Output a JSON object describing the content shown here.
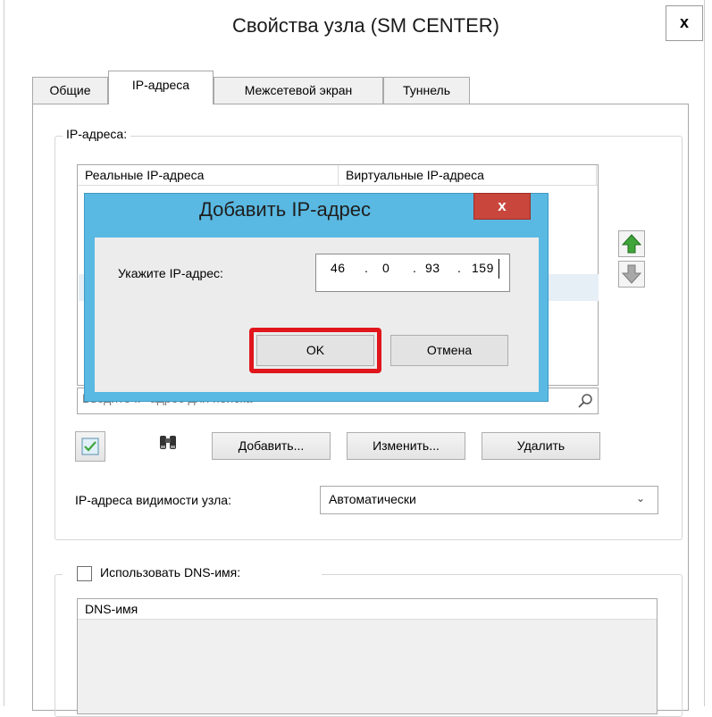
{
  "window": {
    "title": "Свойства узла (SM CENTER)",
    "close_label": "x"
  },
  "tabs": [
    {
      "label": "Общие",
      "active": false
    },
    {
      "label": "IP-адреса",
      "active": true
    },
    {
      "label": "Межсетевой экран",
      "active": false
    },
    {
      "label": "Туннель",
      "active": false
    }
  ],
  "ip_group": {
    "legend": "IP-адреса:",
    "columns": [
      "Реальные IP-адреса",
      "Виртуальные IP-адреса"
    ],
    "search_placeholder": "Введите IP-адрес для поиска",
    "buttons": {
      "add": "Добавить...",
      "edit": "Изменить...",
      "delete": "Удалить"
    },
    "visibility_label": "IP-адреса видимости узла:",
    "visibility_value": "Автоматически"
  },
  "dns_group": {
    "checkbox_label": "Использовать DNS-имя:",
    "checked": false,
    "column": "DNS-имя"
  },
  "dialog": {
    "title": "Добавить IP-адрес",
    "close_label": "x",
    "prompt": "Укажите IP-адрес:",
    "ip_octets": [
      "46",
      "0",
      "93",
      "159"
    ],
    "ip_separator": ".",
    "ok_label": "OK",
    "cancel_label": "Отмена"
  },
  "icons": {
    "move_up": "green-up-arrow-icon",
    "move_down": "gray-down-arrow-icon",
    "search": "magnifier-icon",
    "select_all": "checkbox-list-icon",
    "find": "binoculars-icon"
  },
  "colors": {
    "dialog_frame": "#5ab9e2",
    "dialog_close": "#c9463c",
    "highlight": "#e0161c",
    "up_arrow": "#3fa53a"
  }
}
